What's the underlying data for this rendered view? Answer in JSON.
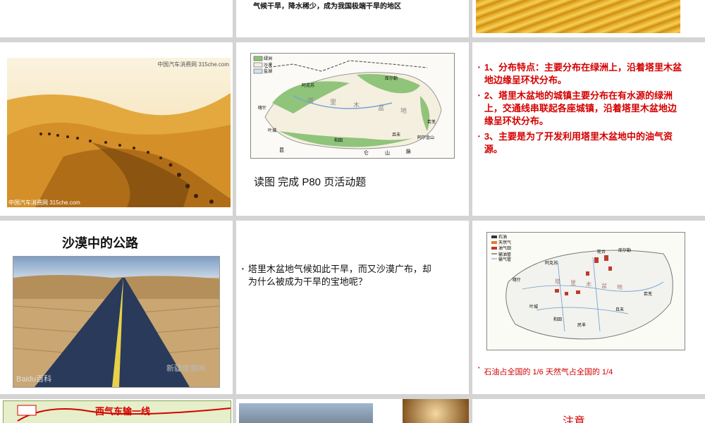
{
  "row1": {
    "caption": "气候干旱，降水稀少，成为我国极端干旱的地区"
  },
  "row2": {
    "desert_photo": {
      "watermark_top": "中国汽车消费网 315che.com",
      "watermark_bottom": "中国汽车消费网 315che.com"
    },
    "map_slide": {
      "caption": "读图  完成 P80 页活动题",
      "legend": [
        "绿洲",
        "沙漠",
        "盐湖"
      ],
      "labels": [
        "阿克苏",
        "库尔勒",
        "塔",
        "里",
        "木",
        "盆",
        "地",
        "和田",
        "且末",
        "若羌",
        "喀什",
        "叶城",
        "昆",
        "仑",
        "山",
        "脉",
        "阿尔金山"
      ]
    },
    "points": {
      "items": [
        "1、分布特点：主要分布在绿洲上，沿着塔里木盆地边缘呈环状分布。",
        "2、塔里木盆地的城镇主要分布在有水源的绿洲上，交通线串联起各座城镇，沿着塔里木盆地边缘呈环状分布。",
        "3、主要是为了开发利用塔里木盆地中的油气资源。"
      ]
    }
  },
  "row3": {
    "road_slide": {
      "title": "沙漠中的公路",
      "watermark": "新疆旅游网",
      "watermark2": "Baidu百科"
    },
    "question": "塔里木盆地气候如此干旱，而又沙漠广布，却为什么被成为干旱的宝地呢？",
    "resource_map": {
      "legend": [
        "石油",
        "天然气",
        "油气田",
        "输油管",
        "输气管"
      ],
      "labels": [
        "轮台",
        "库尔勒",
        "阿克苏",
        "塔",
        "里",
        "木",
        "盆",
        "地",
        "叶城",
        "和田",
        "民丰",
        "且末",
        "若羌",
        "喀什"
      ],
      "caption": "石油占全国的 1/6   天然气占全国的 1/4"
    }
  },
  "row4": {
    "pipeline_title": "西气东输一线",
    "note": "注意"
  },
  "colors": {
    "red": "#d40000",
    "gap": "#d4d4d4",
    "sand": "#d8a23a"
  }
}
